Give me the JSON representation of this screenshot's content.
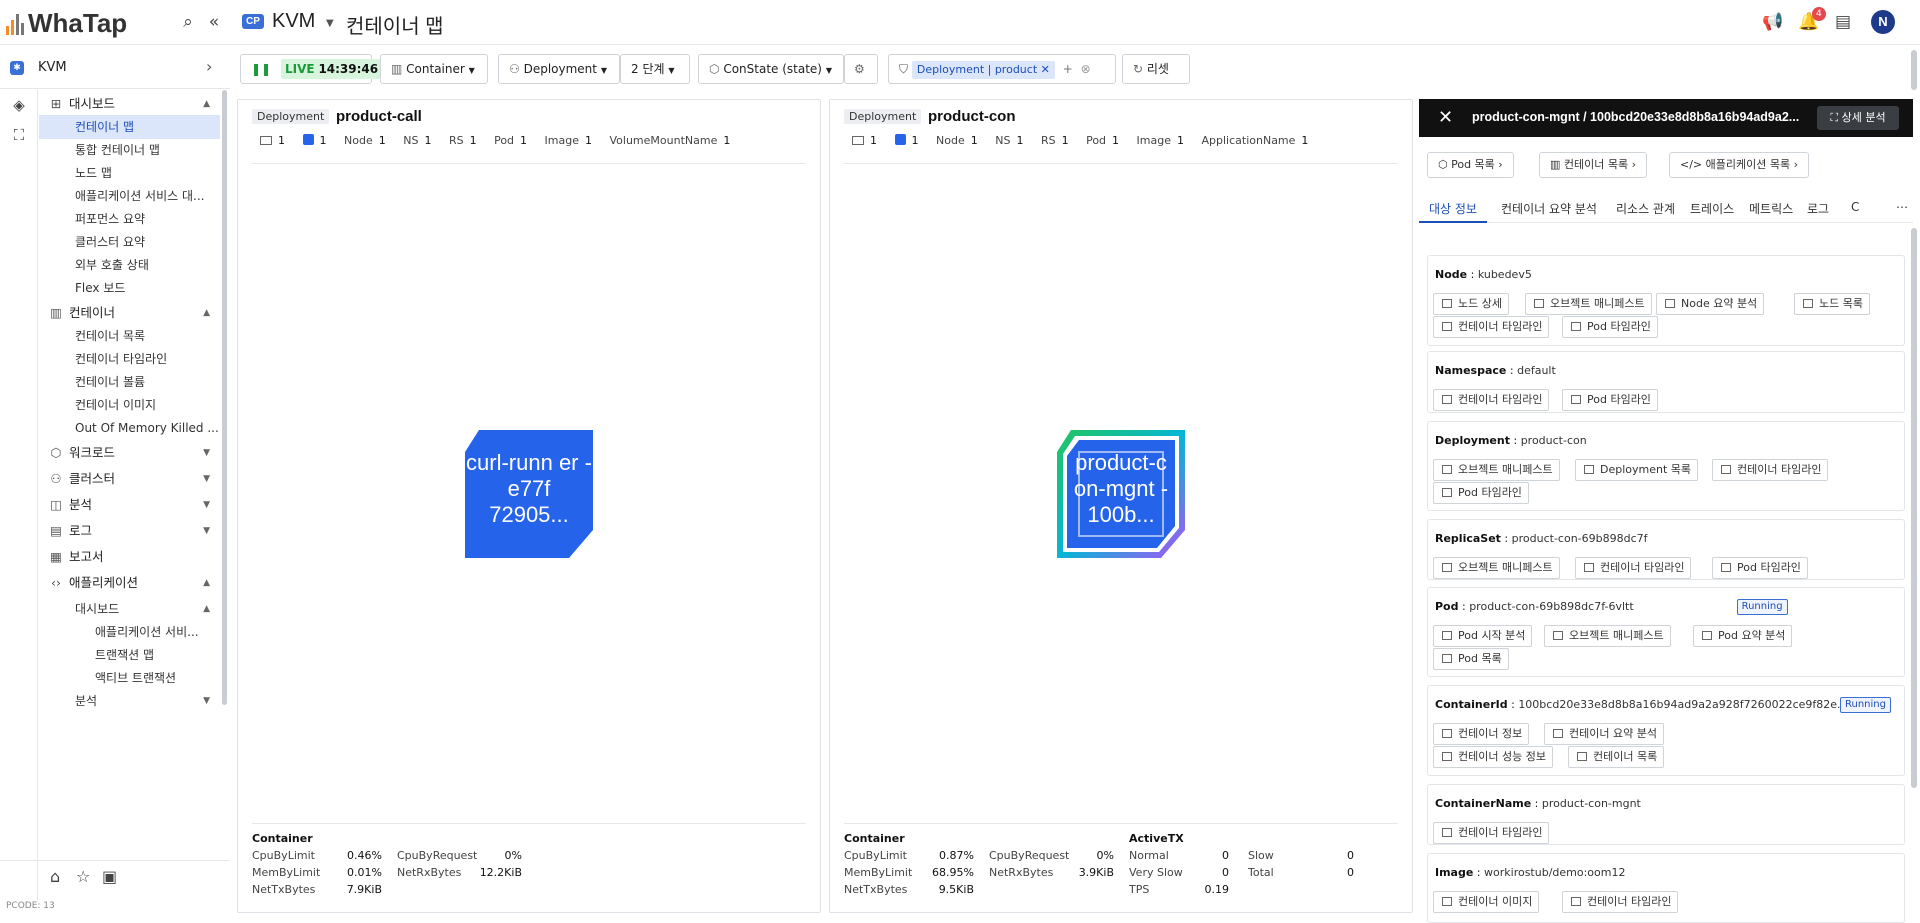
{
  "app": {
    "logo": "WhaTap",
    "project_badge": "CP",
    "project_name": "KVM",
    "page_title": "컨테이너 맵",
    "notification_count": "4",
    "avatar": "N"
  },
  "sidebar": {
    "project": "KVM",
    "items": [
      {
        "label": "대시보드",
        "level": 1,
        "icon": "grid-icon",
        "chevron": "▲"
      },
      {
        "label": "컨테이너 맵",
        "level": 2,
        "active": true
      },
      {
        "label": "통합 컨테이너 맵",
        "level": 2
      },
      {
        "label": "노드 맵",
        "level": 2
      },
      {
        "label": "애플리케이션 서비스 대...",
        "level": 2
      },
      {
        "label": "퍼포먼스 요약",
        "level": 2
      },
      {
        "label": "클러스터 요약",
        "level": 2
      },
      {
        "label": "외부 호출 상태",
        "level": 2
      },
      {
        "label": "Flex 보드",
        "level": 2
      },
      {
        "label": "컨테이너",
        "level": 1,
        "icon": "container-icon",
        "chevron": "▲"
      },
      {
        "label": "컨테이너 목록",
        "level": 2
      },
      {
        "label": "컨테이너 타임라인",
        "level": 2
      },
      {
        "label": "컨테이너 볼륨",
        "level": 2
      },
      {
        "label": "컨테이너 이미지",
        "level": 2
      },
      {
        "label": "Out Of Memory Killed ...",
        "level": 2
      },
      {
        "label": "워크로드",
        "level": 1,
        "icon": "hexagon-icon",
        "chevron": "▼"
      },
      {
        "label": "클러스터",
        "level": 1,
        "icon": "cluster-icon",
        "chevron": "▼"
      },
      {
        "label": "분석",
        "level": 1,
        "icon": "chart-icon",
        "chevron": "▼"
      },
      {
        "label": "로그",
        "level": 1,
        "icon": "log-icon",
        "chevron": "▼"
      },
      {
        "label": "보고서",
        "level": 1,
        "icon": "report-icon",
        "chevron": ""
      },
      {
        "label": "애플리케이션",
        "level": 1,
        "icon": "code-icon",
        "chevron": "▲"
      },
      {
        "label": "대시보드",
        "level": 2,
        "chevron": "▲"
      },
      {
        "label": "애플리케이션 서비...",
        "level": 3
      },
      {
        "label": "트랜잭션 맵",
        "level": 3
      },
      {
        "label": "액티브 트랜잭션",
        "level": 3
      },
      {
        "label": "분석",
        "level": 2,
        "chevron": "▼"
      }
    ],
    "pcode": "PCODE: 13"
  },
  "toolbar": {
    "live_label": "LIVE",
    "time": "14:39:46",
    "container": "Container",
    "deployment": "Deployment",
    "depth": "2 단계",
    "constate": "ConState (state)",
    "filter_chip": "Deployment | product",
    "reset": "리셋"
  },
  "panels": [
    {
      "tag": "Deployment",
      "name": "product-call",
      "stats": {
        "s1": "1",
        "s2": "1",
        "node": "1",
        "ns": "1",
        "rs": "1",
        "pod": "1",
        "image": "1",
        "extra_label": "VolumeMountName",
        "extra": "1"
      },
      "node_text": "curl-runn er - e77f 72905...",
      "metrics": {
        "title": "Container",
        "cpu_by_limit": "0.46%",
        "mem_by_limit": "0.01%",
        "net_tx": "7.9KiB",
        "cpu_by_request": "0%",
        "net_rx": "12.2KiB"
      }
    },
    {
      "tag": "Deployment",
      "name": "product-con",
      "stats": {
        "s1": "1",
        "s2": "1",
        "node": "1",
        "ns": "1",
        "rs": "1",
        "pod": "1",
        "image": "1",
        "extra_label": "ApplicationName",
        "extra": "1"
      },
      "node_text": "product-c on-mgnt - 100b...",
      "metrics": {
        "title": "Container",
        "cpu_by_limit": "0.87%",
        "mem_by_limit": "68.95%",
        "net_tx": "9.5KiB",
        "cpu_by_request": "0%",
        "net_rx": "3.9KiB"
      },
      "activetx": {
        "title": "ActiveTX",
        "normal": "0",
        "very_slow": "0",
        "tps": "0.19",
        "slow": "0",
        "total": "0"
      }
    }
  ],
  "metric_labels": {
    "cpu_by_limit": "CpuByLimit",
    "mem_by_limit": "MemByLimit",
    "net_tx": "NetTxBytes",
    "cpu_by_request": "CpuByRequest",
    "net_rx": "NetRxBytes",
    "normal": "Normal",
    "very_slow": "Very Slow",
    "tps": "TPS",
    "slow": "Slow",
    "total": "Total"
  },
  "stat_labels": {
    "node": "Node",
    "ns": "NS",
    "rs": "RS",
    "pod": "Pod",
    "image": "Image"
  },
  "detail": {
    "title": "product-con-mgnt / 100bcd20e33e8d8b8a16b94ad9a2...",
    "detail_button": "상세 분석",
    "nav_buttons": [
      "Pod 목록",
      "컨테이너 목록",
      "애플리케이션 목록"
    ],
    "tabs": [
      "대상 정보",
      "컨테이너 요약 분석",
      "리소스 관계",
      "트레이스",
      "메트릭스",
      "로그",
      "C"
    ],
    "cards": [
      {
        "label": "Node",
        "value": "kubedev5",
        "buttons": [
          "노드 상세",
          "오브젝트 매니페스트",
          "Node 요약 분석",
          "노드 목록",
          "컨테이너 타임라인",
          "Pod 타임라인"
        ]
      },
      {
        "label": "Namespace",
        "value": "default",
        "buttons": [
          "컨테이너 타임라인",
          "Pod 타임라인"
        ]
      },
      {
        "label": "Deployment",
        "value": "product-con",
        "buttons": [
          "오브젝트 매니페스트",
          "Deployment 목록",
          "컨테이너 타임라인",
          "Pod 타임라인"
        ]
      },
      {
        "label": "ReplicaSet",
        "value": "product-con-69b898dc7f",
        "buttons": [
          "오브젝트 매니페스트",
          "컨테이너 타임라인",
          "Pod 타임라인"
        ]
      },
      {
        "label": "Pod",
        "value": "product-con-69b898dc7f-6vltt",
        "badge": "Running",
        "buttons": [
          "Pod 시작 분석",
          "오브젝트 매니페스트",
          "Pod 요약 분석",
          "Pod 목록"
        ]
      },
      {
        "label": "ContainerId",
        "value": "100bcd20e33e8d8b8a16b94ad9a2a928f7260022ce9f82e...",
        "badge": "Running",
        "buttons": [
          "컨테이너 정보",
          "컨테이너 요약 분석",
          "컨테이너 성능 정보",
          "컨테이너 목록"
        ]
      },
      {
        "label": "ContainerName",
        "value": "product-con-mgnt",
        "buttons": [
          "컨테이너 타임라인"
        ]
      },
      {
        "label": "Image",
        "value": "workirostub/demo:oom12",
        "buttons": [
          "컨테이너 이미지",
          "컨테이너 타임라인"
        ]
      }
    ]
  },
  "colors": {
    "accent": "#1d4fb8",
    "node_fill": "#2563eb",
    "live_green": "#1a9a3a"
  }
}
